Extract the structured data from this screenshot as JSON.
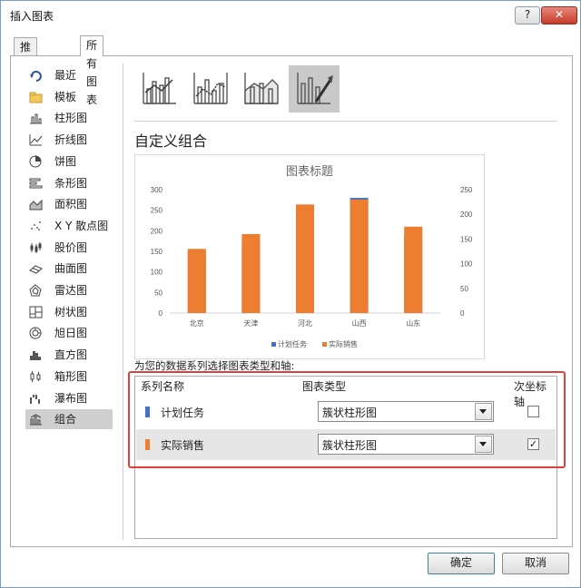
{
  "window": {
    "title": "插入图表",
    "help_label": "?",
    "close_label": "✕"
  },
  "tabs": [
    {
      "label": "推荐的图表"
    },
    {
      "label": "所有图表"
    }
  ],
  "sidebar": {
    "items": [
      {
        "label": "最近",
        "icon": "recent-icon"
      },
      {
        "label": "模板",
        "icon": "folder-icon"
      },
      {
        "label": "柱形图",
        "icon": "column-chart-icon"
      },
      {
        "label": "折线图",
        "icon": "line-chart-icon"
      },
      {
        "label": "饼图",
        "icon": "pie-chart-icon"
      },
      {
        "label": "条形图",
        "icon": "bar-chart-icon"
      },
      {
        "label": "面积图",
        "icon": "area-chart-icon"
      },
      {
        "label": "X Y 散点图",
        "icon": "scatter-chart-icon"
      },
      {
        "label": "股价图",
        "icon": "stock-chart-icon"
      },
      {
        "label": "曲面图",
        "icon": "surface-chart-icon"
      },
      {
        "label": "雷达图",
        "icon": "radar-chart-icon"
      },
      {
        "label": "树状图",
        "icon": "treemap-chart-icon"
      },
      {
        "label": "旭日图",
        "icon": "sunburst-chart-icon"
      },
      {
        "label": "直方图",
        "icon": "histogram-chart-icon"
      },
      {
        "label": "箱形图",
        "icon": "box-chart-icon"
      },
      {
        "label": "瀑布图",
        "icon": "waterfall-chart-icon"
      },
      {
        "label": "组合",
        "icon": "combo-chart-icon"
      }
    ],
    "selected": "组合"
  },
  "subtypes": [
    "clustered-column-line-icon",
    "column-line-secondary-axis-icon",
    "stacked-area-column-icon",
    "custom-combination-icon"
  ],
  "section_title": "自定义组合",
  "chart_data": {
    "type": "bar",
    "title": "图表标题",
    "categories": [
      "北京",
      "天津",
      "河北",
      "山西",
      "山东"
    ],
    "series": [
      {
        "name": "计划任务",
        "values": [
          150,
          175,
          260,
          280,
          190
        ],
        "color": "#4472c4",
        "axis": "primary"
      },
      {
        "name": "实际销售",
        "values": [
          130,
          160,
          220,
          230,
          175
        ],
        "color": "#ed7d31",
        "axis": "secondary"
      }
    ],
    "y_ticks": [
      "0",
      "50",
      "100",
      "150",
      "200",
      "250",
      "300"
    ],
    "y2_ticks": [
      "0",
      "50",
      "100",
      "150",
      "200",
      "250"
    ],
    "ylim": [
      0,
      300
    ],
    "y2lim": [
      0,
      250
    ],
    "legend": "bottom",
    "grid": false
  },
  "instruction": "为您的数据系列选择图表类型和轴:",
  "series_grid": {
    "headers": {
      "name": "系列名称",
      "type": "图表类型",
      "secondary": "次坐标轴"
    },
    "rows": [
      {
        "name": "计划任务",
        "color": "#4472c4",
        "type": "簇状柱形图",
        "secondary": false
      },
      {
        "name": "实际销售",
        "color": "#ed7d31",
        "type": "簇状柱形图",
        "secondary": true
      }
    ]
  },
  "buttons": {
    "ok": "确定",
    "cancel": "取消"
  }
}
